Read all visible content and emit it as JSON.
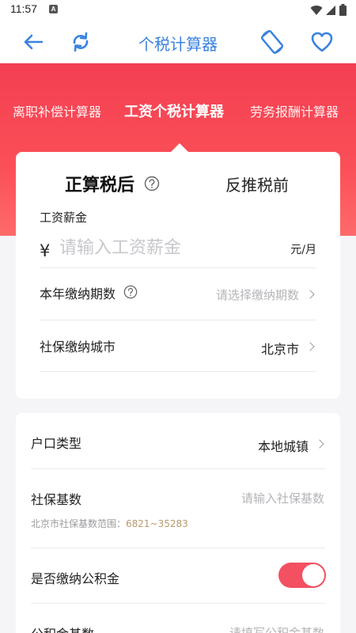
{
  "status_bar": {
    "time": "11:57",
    "notif_badge": "A"
  },
  "toolbar": {
    "title": "个税计算器",
    "accent_color": "#3a82e0",
    "icons": [
      "back-arrow-icon",
      "refresh-icon",
      "rotate-screen-icon",
      "heart-icon"
    ]
  },
  "tabs": [
    {
      "label": "离职补偿计算器"
    },
    {
      "label": "工资个税计算器",
      "active": true
    },
    {
      "label": "劳务报酬计算器"
    }
  ],
  "calc": {
    "mode_forward": "正算税后",
    "mode_backward": "反推税前",
    "salary": {
      "label": "工资薪金",
      "currency": "¥",
      "placeholder": "请输入工资薪金",
      "value": "",
      "unit": "元/月"
    },
    "periods": {
      "label": "本年缴纳期数",
      "placeholder": "请选择缴纳期数"
    },
    "city": {
      "label": "社保缴纳城市",
      "value": "北京市"
    }
  },
  "details": {
    "hukou": {
      "label": "户口类型",
      "value": "本地城镇"
    },
    "base": {
      "label": "社保基数",
      "placeholder": "请输入社保基数",
      "hint_prefix": "北京市社保基数范围：",
      "hint_range": "6821~35283"
    },
    "fund": {
      "label": "是否缴纳公积金",
      "enabled": true
    },
    "fund_base": {
      "label": "公积金基数",
      "placeholder": "请填写公积金基数"
    }
  },
  "colors": {
    "brand_red": "#f33f52",
    "toggle_on": "#f35061",
    "hint_range": "#b9986a"
  }
}
